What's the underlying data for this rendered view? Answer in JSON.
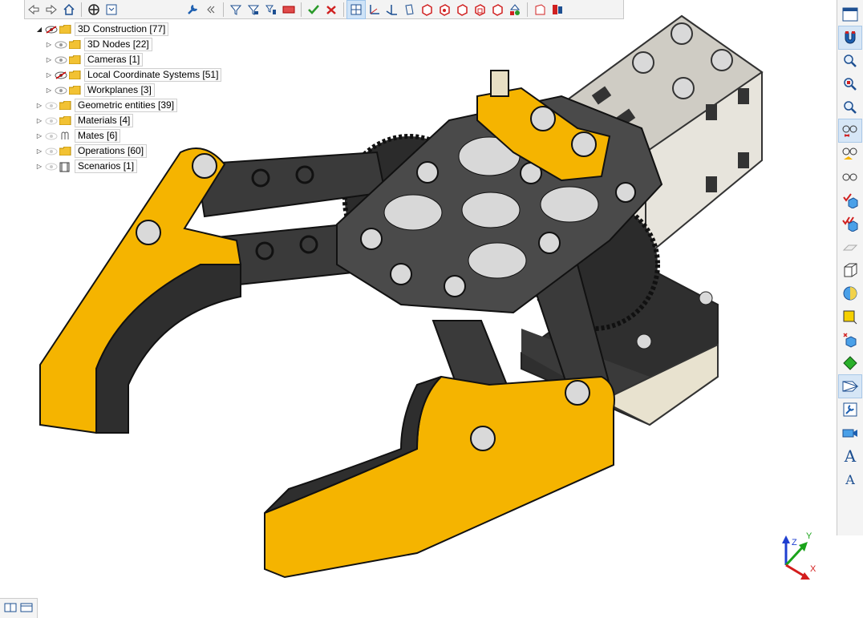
{
  "toolbar": {
    "close_icon": "×",
    "buttons": [
      "back",
      "forward",
      "home",
      "target",
      "collapse",
      "wrench",
      "double-chevron-left",
      "filter",
      "filter-alt",
      "filter-tree",
      "rect-select",
      "check-filter",
      "x-filter",
      "view-front",
      "axes",
      "axes-alt",
      "cylinder",
      "cube-1",
      "cube-2",
      "cube-3",
      "cube-4",
      "cube-5",
      "shapes",
      "page",
      "wizard"
    ]
  },
  "tree": {
    "items": [
      {
        "label": "3D Construction [77]",
        "level": 0,
        "expanded": true,
        "eye": "hidden"
      },
      {
        "label": "3D Nodes [22]",
        "level": 1,
        "expanded": false,
        "eye": "visible"
      },
      {
        "label": "Cameras [1]",
        "level": 1,
        "expanded": false,
        "eye": "visible"
      },
      {
        "label": "Local Coordinate Systems [51]",
        "level": 1,
        "expanded": false,
        "eye": "hidden"
      },
      {
        "label": "Workplanes [3]",
        "level": 1,
        "expanded": false,
        "eye": "visible"
      },
      {
        "label": "Geometric entities [39]",
        "level": 0,
        "expanded": false,
        "eye": "visible"
      },
      {
        "label": "Materials [4]",
        "level": 0,
        "expanded": false,
        "eye": "visible"
      },
      {
        "label": "Mates [6]",
        "level": 0,
        "expanded": false,
        "eye": "visible"
      },
      {
        "label": "Operations [60]",
        "level": 0,
        "expanded": false,
        "eye": "visible"
      },
      {
        "label": "Scenarios [1]",
        "level": 0,
        "expanded": false,
        "eye": "visible"
      }
    ]
  },
  "triad": {
    "x_label": "X",
    "y_label": "Y",
    "z_label": "Z"
  },
  "colors": {
    "accent": "#f5b400",
    "dark_part": "#3b3b3b",
    "plate": "#4a4a4a",
    "metal": "#d9d9d9",
    "select": "#cfe3f7"
  }
}
